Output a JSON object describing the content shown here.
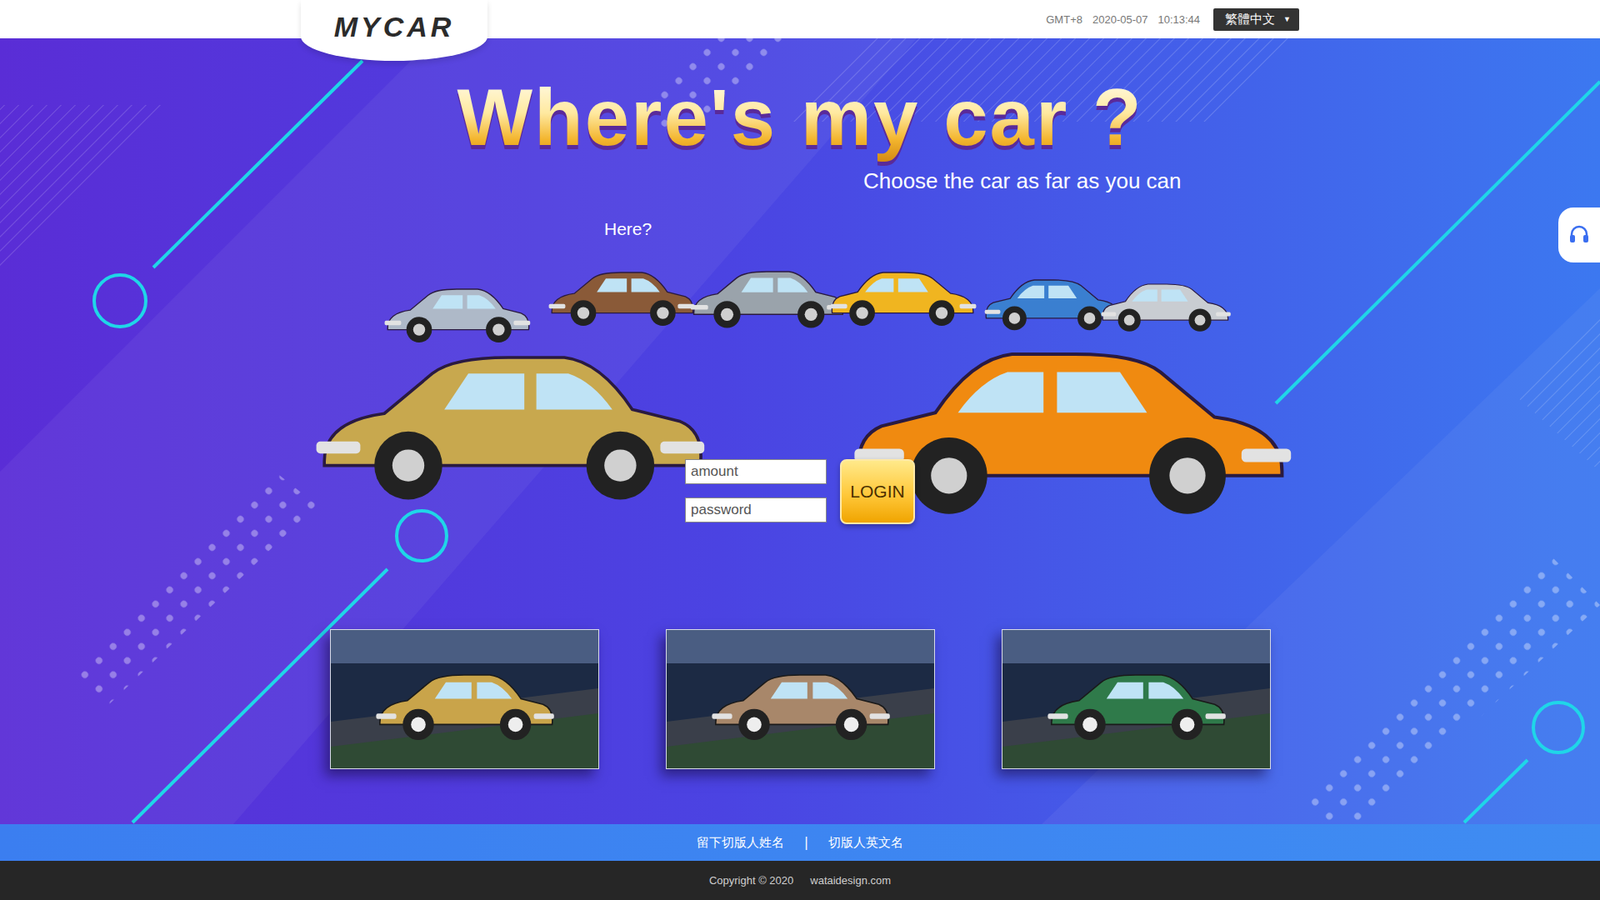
{
  "header": {
    "logo": "MYCAR",
    "timezone": "GMT+8",
    "date": "2020-05-07",
    "time": "10:13:44",
    "language": {
      "label": "繁體中文",
      "icon": "▼"
    }
  },
  "hero": {
    "title": "Where's my car ?",
    "subtitle": "Choose the car as far as you can",
    "hint": "Here?"
  },
  "login": {
    "fields": [
      {
        "placeholder": "amount",
        "kind": "text"
      },
      {
        "placeholder": "password",
        "kind": "password"
      }
    ],
    "button": "LOGIN"
  },
  "thumbnails": [
    {
      "color": "#c9a44a"
    },
    {
      "color": "#a8876a"
    },
    {
      "color": "#2f7a4a"
    }
  ],
  "footer": {
    "links": [
      "留下切版人姓名",
      "切版人英文名"
    ],
    "separator": "|",
    "copyright": "Copyright © 2020",
    "site": "wataidesign.com"
  }
}
